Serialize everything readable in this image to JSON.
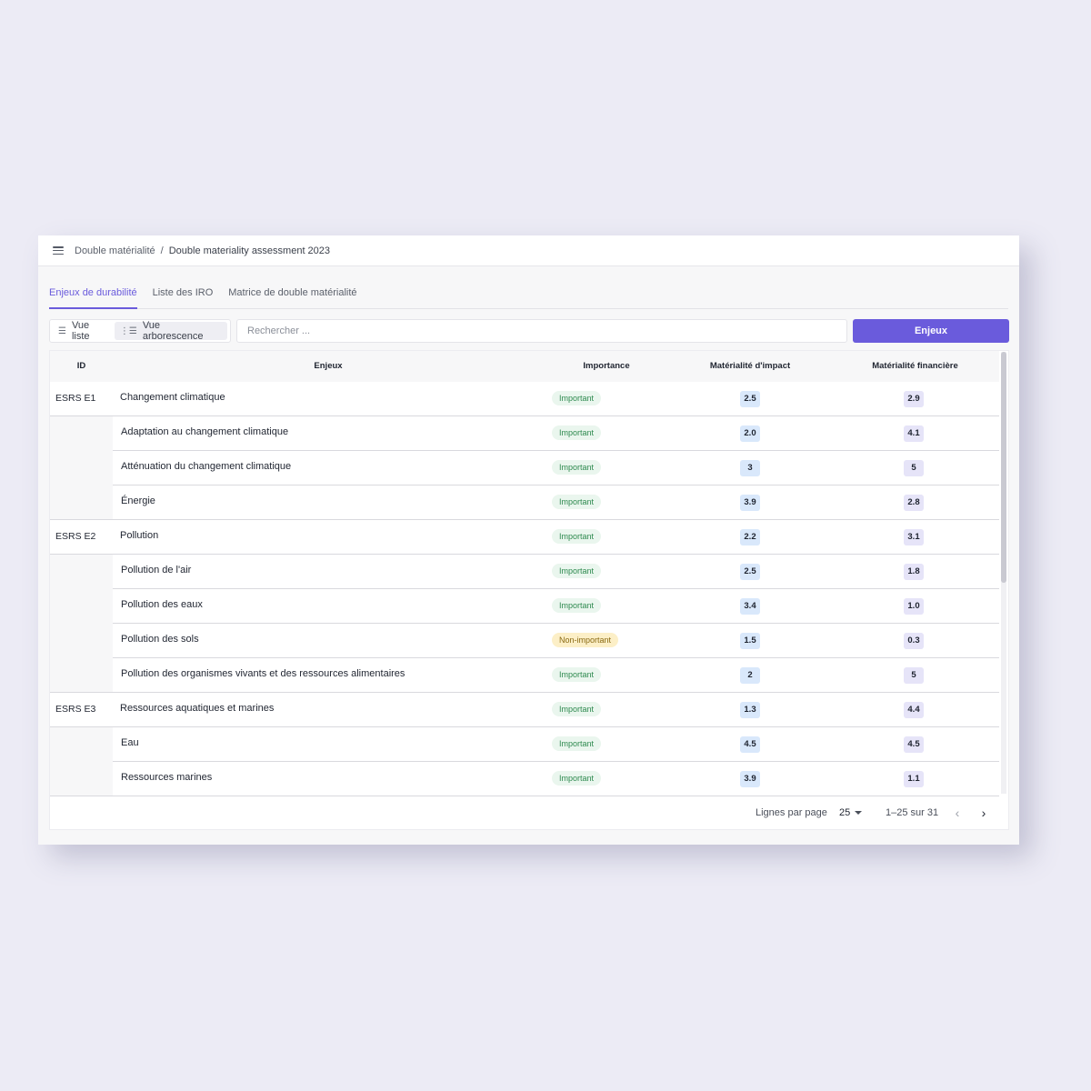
{
  "breadcrumb": {
    "root": "Double matérialité",
    "separator": "/",
    "current": "Double materiality assessment 2023"
  },
  "tabs": [
    {
      "label": "Enjeux de durabilité",
      "active": true
    },
    {
      "label": "Liste des IRO",
      "active": false
    },
    {
      "label": "Matrice de double matérialité",
      "active": false
    }
  ],
  "toolbar": {
    "list_view": "Vue liste",
    "tree_view": "Vue arborescence",
    "search_placeholder": "Rechercher ...",
    "primary_button": "Enjeux"
  },
  "table": {
    "columns": {
      "id": "ID",
      "name": "Enjeux",
      "importance": "Importance",
      "impact": "Matérialité d'impact",
      "financial": "Matérialité financière"
    },
    "rows": [
      {
        "id": "ESRS E1",
        "name": "Changement climatique",
        "importance": "Important",
        "impact": "2.5",
        "financial": "2.9",
        "level": "parent"
      },
      {
        "id": "",
        "name": "Adaptation au changement climatique",
        "importance": "Important",
        "impact": "2.0",
        "financial": "4.1",
        "level": "child"
      },
      {
        "id": "",
        "name": "Atténuation du changement climatique",
        "importance": "Important",
        "impact": "3",
        "financial": "5",
        "level": "child"
      },
      {
        "id": "",
        "name": "Énergie",
        "importance": "Important",
        "impact": "3.9",
        "financial": "2.8",
        "level": "child"
      },
      {
        "id": "ESRS E2",
        "name": "Pollution",
        "importance": "Important",
        "impact": "2.2",
        "financial": "3.1",
        "level": "parent"
      },
      {
        "id": "",
        "name": "Pollution de l'air",
        "importance": "Important",
        "impact": "2.5",
        "financial": "1.8",
        "level": "child"
      },
      {
        "id": "",
        "name": "Pollution des eaux",
        "importance": "Important",
        "impact": "3.4",
        "financial": "1.0",
        "level": "child"
      },
      {
        "id": "",
        "name": "Pollution des sols",
        "importance": "Non-important",
        "impact": "1.5",
        "financial": "0.3",
        "level": "child"
      },
      {
        "id": "",
        "name": "Pollution des organismes vivants et des ressources alimentaires",
        "importance": "Important",
        "impact": "2",
        "financial": "5",
        "level": "child"
      },
      {
        "id": "ESRS E3",
        "name": "Ressources aquatiques et marines",
        "importance": "Important",
        "impact": "1.3",
        "financial": "4.4",
        "level": "parent"
      },
      {
        "id": "",
        "name": "Eau",
        "importance": "Important",
        "impact": "4.5",
        "financial": "4.5",
        "level": "child"
      },
      {
        "id": "",
        "name": "Ressources marines",
        "importance": "Important",
        "impact": "3.9",
        "financial": "1.1",
        "level": "child"
      }
    ]
  },
  "pagination": {
    "rows_per_page_label": "Lignes par page",
    "rows_per_page": "25",
    "range": "1–25 sur 31"
  },
  "icons": {
    "menu": "hamburger-icon",
    "list_view": "list-icon",
    "tree_view": "tree-icon",
    "prev": "chevron-left-icon",
    "next": "chevron-right-icon",
    "dropdown": "caret-down-icon"
  },
  "colors": {
    "accent": "#6a5bdc",
    "important_bg": "#eaf6ee",
    "important_text": "#2e8a4f",
    "non_important_bg": "#fcefc7",
    "non_important_text": "#8a6a13",
    "impact_chip": "#d9e8fb",
    "financial_chip": "#e6e4f8"
  }
}
